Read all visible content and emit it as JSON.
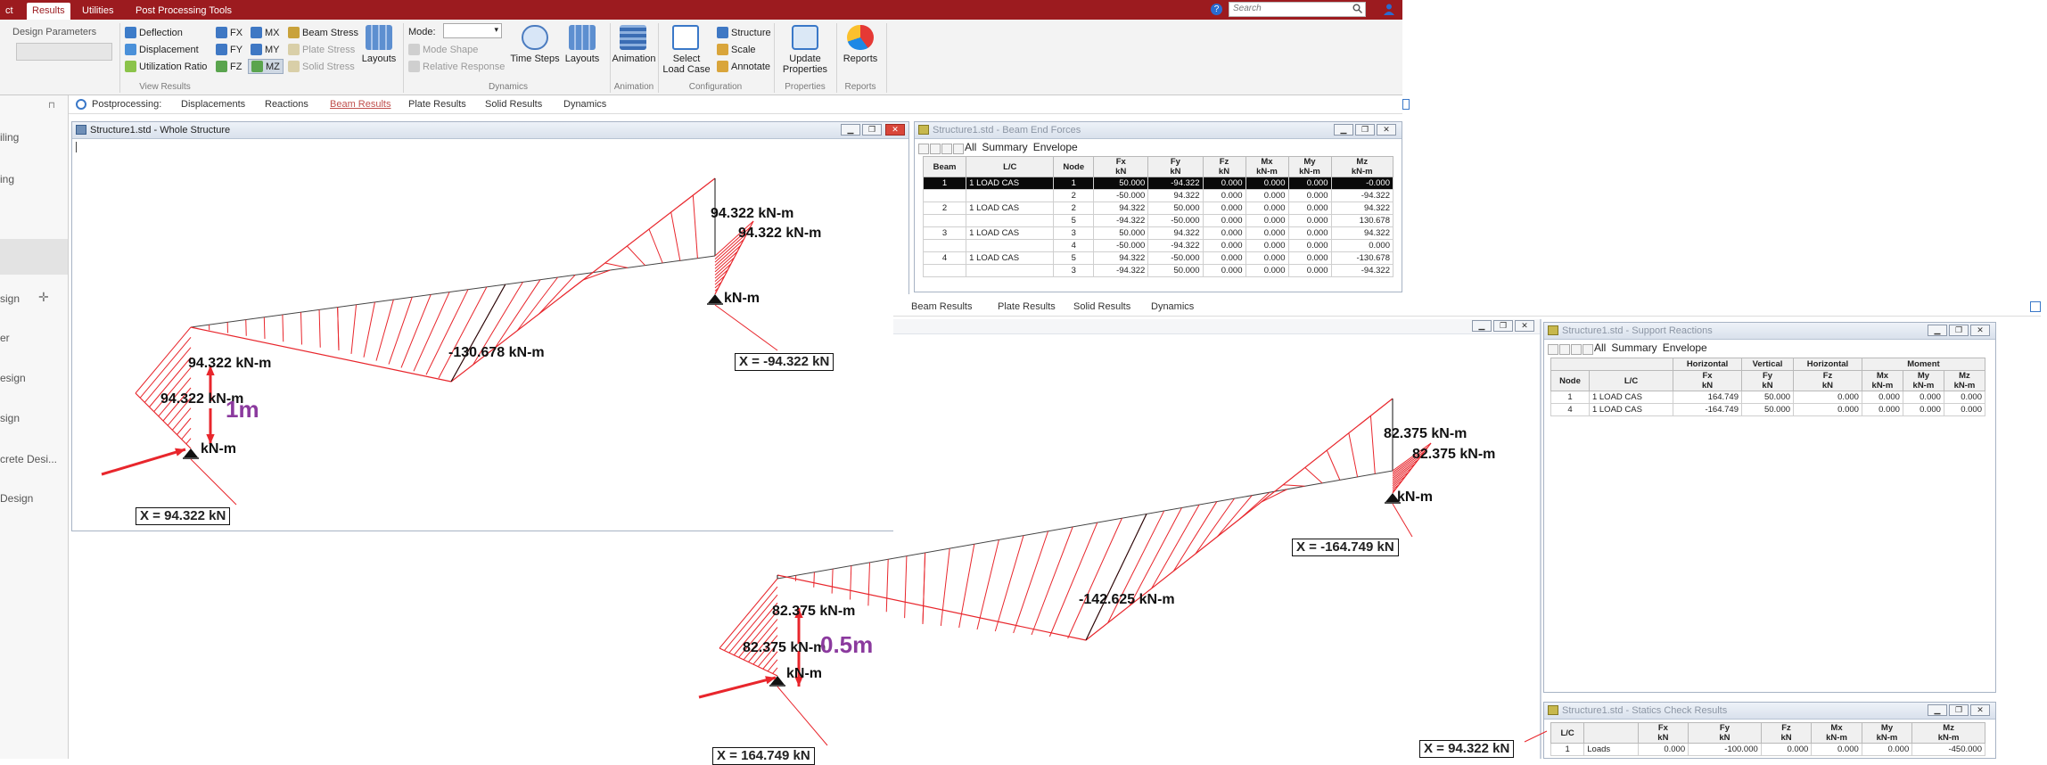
{
  "ribbon": {
    "tabs": [
      "ct",
      "Results",
      "Utilities",
      "Post Processing Tools"
    ],
    "search_placeholder": "Search",
    "design_parameters_label": "Design Parameters",
    "view_results": {
      "deflection": "Deflection",
      "displacement": "Displacement",
      "utilization_ratio": "Utilization Ratio",
      "group": "View Results"
    },
    "forces": {
      "fx": "FX",
      "fy": "FY",
      "fz": "FZ",
      "mx": "MX",
      "my": "MY",
      "mz": "MZ"
    },
    "stress": {
      "beam": "Beam Stress",
      "plate": "Plate Stress",
      "solid": "Solid Stress"
    },
    "layouts": "Layouts",
    "dynamics": {
      "mode_label": "Mode:",
      "mode_shape": "Mode Shape",
      "relative_response": "Relative Response",
      "time_steps": "Time Steps",
      "layouts": "Layouts",
      "group": "Dynamics"
    },
    "animation": {
      "label": "Animation",
      "group": "Animation"
    },
    "configuration": {
      "select_load_case": "Select Load Case",
      "structure": "Structure",
      "scale": "Scale",
      "annotate": "Annotate",
      "group": "Configuration"
    },
    "properties": {
      "update": "Update Properties",
      "group": "Properties"
    },
    "reports": {
      "label": "Reports",
      "group": "Reports"
    }
  },
  "sidepanel": {
    "items": [
      "iling",
      "ing",
      "sign",
      "er",
      "esign",
      "sign",
      "crete Desi...",
      "Design"
    ]
  },
  "postprocessing": {
    "label": "Postprocessing:",
    "tabs": [
      "Displacements",
      "Reactions",
      "Beam Results",
      "Plate Results",
      "Solid Results",
      "Dynamics"
    ],
    "active": "Beam Results",
    "tabs2": [
      "Beam Results",
      "Plate Results",
      "Solid Results",
      "Dynamics"
    ]
  },
  "viewport": {
    "title": "Structure1.std - Whole Structure",
    "model1": {
      "labels": {
        "top_right_1": "94.322 kN-m",
        "top_right_2": "94.322 kN-m",
        "right_support": "kN-m",
        "mid": "-130.678 kN-m",
        "left_1": "94.322 kN-m",
        "left_2": "94.322 kN-m",
        "left_support": "kN-m",
        "dimension": "1m"
      },
      "reactions": {
        "left": "X = 94.322 kN",
        "right": "X = -94.322 kN"
      }
    },
    "model2": {
      "labels": {
        "top_right_1": "82.375 kN-m",
        "top_right_2": "82.375 kN-m",
        "right_support": "kN-m",
        "mid": "-142.625 kN-m",
        "left_1": "82.375 kN-m",
        "left_2": "82.375 kN-m",
        "left_support": "kN-m",
        "dimension": "0.5m"
      },
      "reactions": {
        "left": "X = 164.749 kN",
        "right": "X = -164.749 kN",
        "extra": "X = 94.322 kN"
      }
    }
  },
  "beam_end_forces": {
    "title": "Structure1.std - Beam End Forces",
    "subtabs": [
      "All",
      "Summary",
      "Envelope"
    ],
    "columns": [
      "Beam",
      "L/C",
      "Node",
      "Fx\nkN",
      "Fy\nkN",
      "Fz\nkN",
      "Mx\nkN-m",
      "My\nkN-m",
      "Mz\nkN-m"
    ],
    "rows": [
      [
        "1",
        "1 LOAD CAS",
        "1",
        "50.000",
        "-94.322",
        "0.000",
        "0.000",
        "0.000",
        "-0.000"
      ],
      [
        "",
        "",
        "2",
        "-50.000",
        "94.322",
        "0.000",
        "0.000",
        "0.000",
        "-94.322"
      ],
      [
        "2",
        "1 LOAD CAS",
        "2",
        "94.322",
        "50.000",
        "0.000",
        "0.000",
        "0.000",
        "94.322"
      ],
      [
        "",
        "",
        "5",
        "-94.322",
        "-50.000",
        "0.000",
        "0.000",
        "0.000",
        "130.678"
      ],
      [
        "3",
        "1 LOAD CAS",
        "3",
        "50.000",
        "94.322",
        "0.000",
        "0.000",
        "0.000",
        "94.322"
      ],
      [
        "",
        "",
        "4",
        "-50.000",
        "-94.322",
        "0.000",
        "0.000",
        "0.000",
        "0.000"
      ],
      [
        "4",
        "1 LOAD CAS",
        "5",
        "94.322",
        "-50.000",
        "0.000",
        "0.000",
        "0.000",
        "-130.678"
      ],
      [
        "",
        "",
        "3",
        "-94.322",
        "50.000",
        "0.000",
        "0.000",
        "0.000",
        "-94.322"
      ]
    ]
  },
  "support_reactions": {
    "title": "Structure1.std - Support Reactions",
    "subtabs": [
      "All",
      "Summary",
      "Envelope"
    ],
    "group_headers": [
      "Horizontal",
      "Vertical",
      "Horizontal",
      "Moment"
    ],
    "columns": [
      "Node",
      "L/C",
      "Fx\nkN",
      "Fy\nkN",
      "Fz\nkN",
      "Mx\nkN-m",
      "My\nkN-m",
      "Mz\nkN-m"
    ],
    "rows": [
      [
        "1",
        "1 LOAD CAS",
        "164.749",
        "50.000",
        "0.000",
        "0.000",
        "0.000",
        "0.000"
      ],
      [
        "4",
        "1 LOAD CAS",
        "-164.749",
        "50.000",
        "0.000",
        "0.000",
        "0.000",
        "0.000"
      ]
    ]
  },
  "statics_check": {
    "title": "Structure1.std - Statics Check Results",
    "columns": [
      "L/C",
      "",
      "Fx\nkN",
      "Fy\nkN",
      "Fz\nkN",
      "Mx\nkN-m",
      "My\nkN-m",
      "Mz\nkN-m"
    ],
    "rows": [
      [
        "1",
        "Loads",
        "0.000",
        "-100.000",
        "0.000",
        "0.000",
        "0.000",
        "-450.000"
      ]
    ]
  },
  "colors": {
    "brand": "#9c1b1f",
    "diagram": "#e8262c",
    "dimension": "#8b3a9e"
  }
}
